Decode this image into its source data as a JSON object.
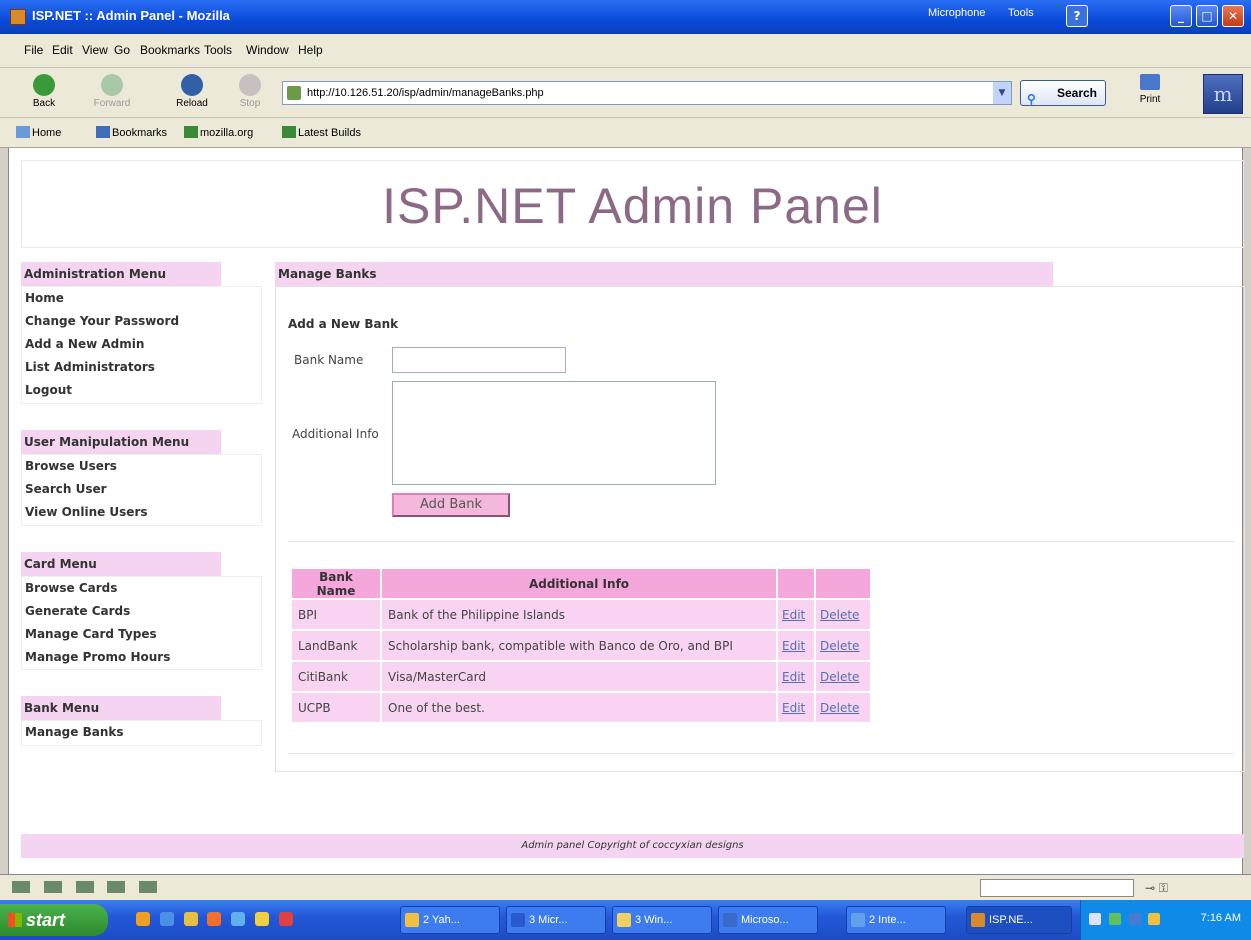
{
  "window": {
    "title": "ISP.NET :: Admin Panel - Mozilla",
    "widgets": [
      "Microphone",
      "Tools"
    ]
  },
  "menubar": [
    "File",
    "Edit",
    "View",
    "Go",
    "Bookmarks",
    "Tools",
    "Window",
    "Help"
  ],
  "navbar": {
    "back": "Back",
    "forward": "Forward",
    "reload": "Reload",
    "stop": "Stop",
    "url": "http://10.126.51.20/isp/admin/manageBanks.php",
    "search": "Search",
    "print": "Print"
  },
  "personal_toolbar": [
    "Home",
    "Bookmarks",
    "mozilla.org",
    "Latest Builds"
  ],
  "page": {
    "header": "ISP.NET Admin Panel",
    "sidebar": [
      {
        "title": "Administration Menu",
        "items": [
          "Home",
          "Change Your Password",
          "Add a New Admin",
          "List Administrators",
          "Logout"
        ]
      },
      {
        "title": "User Manipulation Menu",
        "items": [
          "Browse Users",
          "Search User",
          "View Online Users"
        ]
      },
      {
        "title": "Card Menu",
        "items": [
          "Browse Cards",
          "Generate Cards",
          "Manage Card Types",
          "Manage Promo Hours"
        ]
      },
      {
        "title": "Bank Menu",
        "items": [
          "Manage Banks"
        ]
      }
    ],
    "main": {
      "section_title": "Manage Banks",
      "form": {
        "title": "Add a New Bank",
        "bank_name_label": "Bank Name",
        "additional_info_label": "Additional Info",
        "bank_name_value": "",
        "additional_info_value": "",
        "submit": "Add Bank"
      },
      "table": {
        "headers": [
          "Bank Name",
          "Additional Info",
          "",
          ""
        ],
        "edit_label": "Edit",
        "delete_label": "Delete",
        "rows": [
          {
            "name": "BPI",
            "info": "Bank of the Philippine Islands"
          },
          {
            "name": "LandBank",
            "info": "Scholarship bank, compatible with Banco de Oro, and BPI"
          },
          {
            "name": "CitiBank",
            "info": "Visa/MasterCard"
          },
          {
            "name": "UCPB",
            "info": "One of the best."
          }
        ]
      }
    },
    "footer": "Admin panel Copyright of coccyxian designs"
  },
  "taskbar": {
    "start": "start",
    "tasks": [
      "2 Yah...",
      "3 Micr...",
      "3 Win...",
      "Microso...",
      "2 Inte...",
      "ISP.NE..."
    ],
    "clock": "7:16 AM"
  }
}
